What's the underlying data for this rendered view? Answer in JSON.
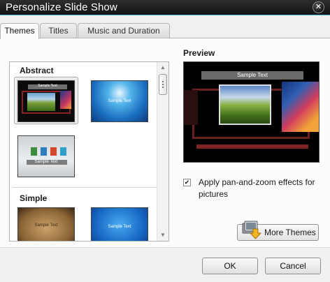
{
  "window": {
    "title": "Personalize Slide Show",
    "close_glyph": "✕"
  },
  "tabs": [
    {
      "label": "Themes",
      "active": true
    },
    {
      "label": "Titles",
      "active": false
    },
    {
      "label": "Music and Duration",
      "active": false
    }
  ],
  "themes": {
    "groups": [
      {
        "name": "Abstract",
        "items": [
          {
            "text": "Sample Text",
            "selected": true
          },
          {
            "text": "Sample Text",
            "selected": false
          },
          {
            "text": "Sample Text",
            "selected": false
          }
        ]
      },
      {
        "name": "Simple",
        "items": [
          {
            "text": "Sample Text",
            "selected": false
          },
          {
            "text": "Sample Text",
            "selected": false
          }
        ]
      }
    ]
  },
  "preview": {
    "label": "Preview",
    "sample_text": "Sample Text"
  },
  "pan_zoom": {
    "label": "Apply pan-and-zoom effects for pictures",
    "checked": true,
    "check_glyph": "✔"
  },
  "more_themes": {
    "label": "More Themes"
  },
  "footer": {
    "ok_label": "OK",
    "cancel_label": "Cancel"
  },
  "scroll": {
    "up_glyph": "▲",
    "down_glyph": "▼"
  },
  "colors": {
    "accent_line": "#3fb2c8",
    "titlebar_bg": "#1a1a1a",
    "panel_bg": "#fcfcfc"
  }
}
